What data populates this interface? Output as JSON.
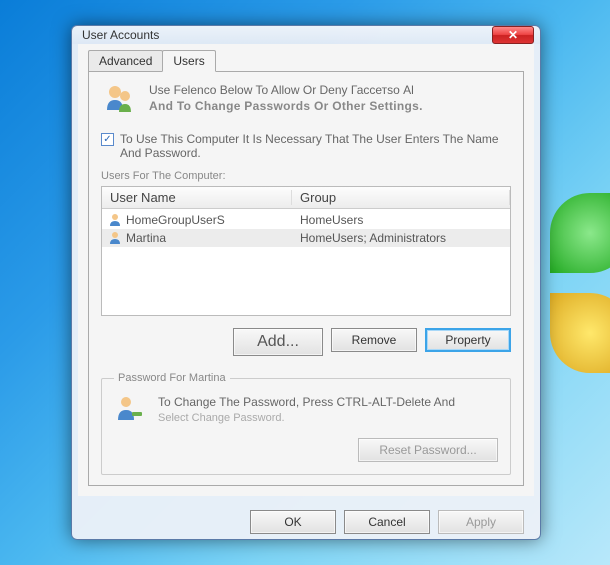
{
  "window": {
    "title": "User Accounts"
  },
  "tabs": {
    "advanced": "Advanced",
    "users": "Users"
  },
  "intro": {
    "line1": "Use Felenco Below To Allow Or Deny Гассетѕо Al",
    "line2": "And To Change Passwords Or Other Settings."
  },
  "checkbox": {
    "label": "To Use This Computer It Is Necessary That The User Enters The Name And Password."
  },
  "users_section": {
    "label": "Users For The Computer:",
    "columns": {
      "name": "User Name",
      "group": "Group"
    },
    "rows": [
      {
        "name": "HomeGroupUserS",
        "group": "HomeUsers"
      },
      {
        "name": "Martina",
        "group": "HomeUsers; Administrators"
      }
    ]
  },
  "buttons": {
    "add": "Add...",
    "remove": "Remove",
    "property": "Property",
    "reset_password": "Reset Password...",
    "ok": "OK",
    "cancel": "Cancel",
    "apply": "Apply"
  },
  "password_section": {
    "legend": "Password For Martina",
    "line1": "To Change The Password, Press CTRL-ALT-Delete And",
    "line2": "Select Change Password."
  },
  "icons": {
    "close": "✕",
    "check": "✓"
  }
}
